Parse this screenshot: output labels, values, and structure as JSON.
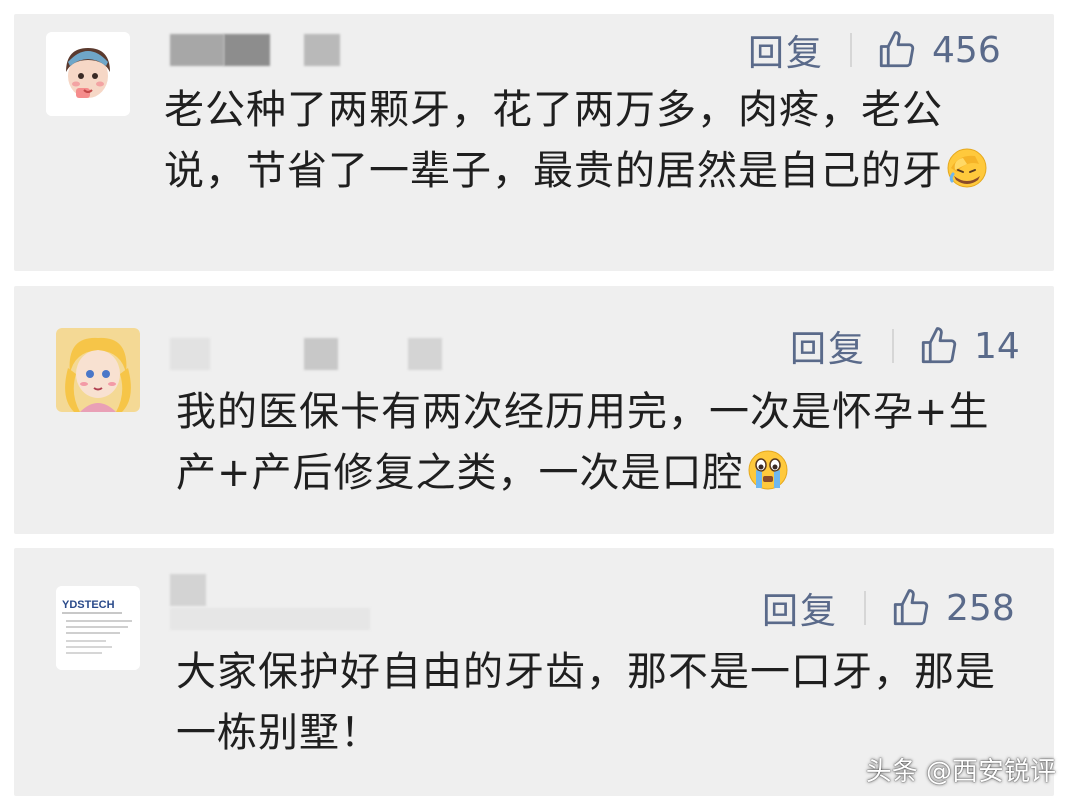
{
  "comments": [
    {
      "reply_label": "回复",
      "like_count": "456",
      "text": "老公种了两颗牙，花了两万多，肉疼，老公说，节省了一辈子，最贵的居然是自己的牙",
      "emoji": "facepalm-laughing-emoji"
    },
    {
      "reply_label": "回复",
      "like_count": "14",
      "text": "我的医保卡有两次经历用完，一次是怀孕+生产+产后修复之类，一次是口腔",
      "emoji": "crying-emoji"
    },
    {
      "reply_label": "回复",
      "like_count": "258",
      "text": "大家保护好自由的牙齿，那不是一口牙，那是一栋别墅！",
      "avatar_brand": "YDSTECH"
    }
  ],
  "watermark": "头条 @西安锐评",
  "colors": {
    "card_bg": "#efefef",
    "action_text": "#5a6a8a",
    "comment_text": "#1f1f1f"
  },
  "icons": [
    "thumbs-up-icon",
    "avatar-cartoon-girl",
    "avatar-anime-girl",
    "avatar-document"
  ]
}
